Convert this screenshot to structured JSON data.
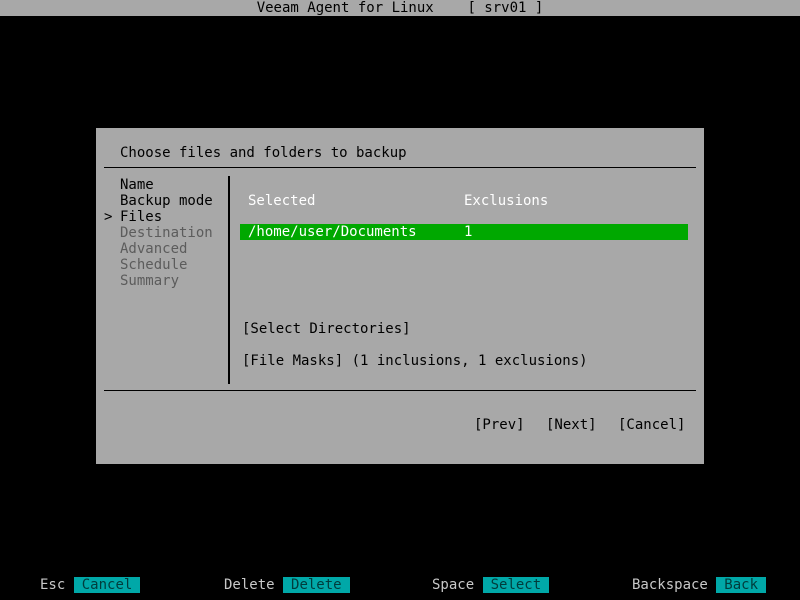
{
  "window": {
    "title": "Veeam Agent for Linux",
    "host": "[ srv01 ]"
  },
  "dialog": {
    "heading": "Choose files and folders to backup",
    "steps": [
      {
        "label": "Name",
        "state": "done"
      },
      {
        "label": "Backup mode",
        "state": "done"
      },
      {
        "label": "Files",
        "state": "current",
        "marker": ">"
      },
      {
        "label": "Destination",
        "state": "pending"
      },
      {
        "label": "Advanced",
        "state": "pending"
      },
      {
        "label": "Schedule",
        "state": "pending"
      },
      {
        "label": "Summary",
        "state": "pending"
      }
    ],
    "table": {
      "headers": {
        "selected": "Selected",
        "exclusions": "Exclusions"
      },
      "rows": [
        {
          "path": "/home/user/Documents",
          "exclusions": "1"
        }
      ]
    },
    "select_directories": "[Select Directories]",
    "file_masks": "[File Masks] (1 inclusions, 1 exclusions)",
    "buttons": {
      "prev": "[Prev]",
      "next": "[Next]",
      "cancel": "[Cancel]"
    }
  },
  "keybar": [
    {
      "key": "Esc",
      "action": "Cancel"
    },
    {
      "key": "Delete",
      "action": "Delete"
    },
    {
      "key": "Space",
      "action": "Select"
    },
    {
      "key": "Backspace",
      "action": "Back"
    }
  ],
  "colors": {
    "background": "#000000",
    "dialog": "#a8a8a8",
    "selection": "#00a800",
    "key_action": "#00a8a8"
  }
}
